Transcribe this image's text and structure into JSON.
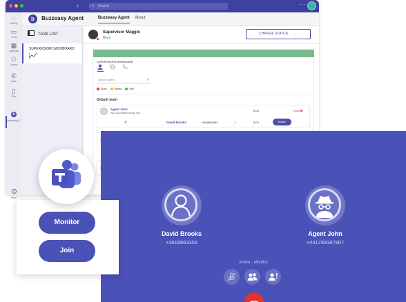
{
  "colors": {
    "accent": "#4b4fa8",
    "call_panel": "#4a52b8",
    "title_bar": "#3f41a0",
    "status_green": "#7cba8d",
    "busy_red": "#e33",
    "hangup_red": "#e0342c"
  },
  "window": {
    "search_placeholder": "Search",
    "nav_arrows": "‹ ›",
    "more_label": "···"
  },
  "rail": {
    "items": [
      {
        "label": "Activity",
        "icon": "bell-icon",
        "glyph": "🔔"
      },
      {
        "label": "Chat",
        "icon": "chat-icon",
        "glyph": "💬"
      },
      {
        "label": "Calendar",
        "icon": "calendar-icon",
        "glyph": "📅"
      },
      {
        "label": "Teams",
        "icon": "teams-icon",
        "glyph": "👥"
      },
      {
        "label": "Calls",
        "icon": "phone-icon",
        "glyph": "📞"
      },
      {
        "label": "Files",
        "icon": "file-icon",
        "glyph": "📄"
      },
      {
        "label": "Buzzeasy A...",
        "icon": "buzzeasy-icon",
        "glyph": "b"
      }
    ],
    "help_label": "Help",
    "help_glyph": "?"
  },
  "app": {
    "logo_letter": "b",
    "name": "Buzzeasy Agent",
    "tabs": [
      "Buzzeasy Agent",
      "About"
    ]
  },
  "left": {
    "task_list": "TASK LIST",
    "dashboard": "SUPERVISOR DASHBOARD"
  },
  "supervisor": {
    "name": "Supervisor Maggie",
    "state": "Busy",
    "change_status": "CHANGE STATUS"
  },
  "dashboard": {
    "title": "SUPERVISOR DASHBOARD",
    "search_placeholder": "Search agent",
    "legend": [
      {
        "label": "Busy",
        "color": "#e33"
      },
      {
        "label": "Break",
        "color": "#f2b23a"
      },
      {
        "label": "Idle",
        "color": "#3cb371"
      }
    ],
    "team": "Default team",
    "agent": {
      "name": "Agent John",
      "email": "bat-support@buzzeasy.com",
      "time": "5:04",
      "status": "Busy"
    },
    "call": {
      "caller": "David Brooks",
      "number": "+3618863353",
      "check": "✓",
      "time": "5:04",
      "action": "Monitor"
    }
  },
  "call_panel": {
    "left": {
      "name": "David Brooks",
      "number": "+3618863355"
    },
    "right": {
      "name": "Agent John",
      "number": "+441789387807"
    },
    "status": "Active - Monitor"
  },
  "actions": {
    "monitor": "Monitor",
    "join": "Join"
  }
}
